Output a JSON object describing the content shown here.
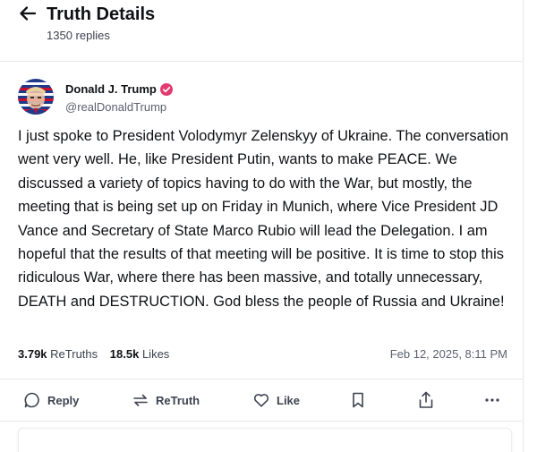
{
  "header": {
    "title": "Truth Details",
    "replies": "1350 replies"
  },
  "post": {
    "author": {
      "name": "Donald J. Trump",
      "handle": "@realDonaldTrump",
      "verified": true
    },
    "text": "I just spoke to President Volodymyr Zelenskyy of Ukraine. The conversation went very well. He, like President Putin, wants to make PEACE. We discussed a variety of topics having to do with the War, but mostly, the meeting that is being set up on Friday in Munich, where Vice President JD Vance and Secretary of State Marco Rubio will lead the Delegation. I am hopeful that the results of that meeting will be positive. It is time to stop this ridiculous War, where there has been massive, and totally unnecessary, DEATH and DESTRUCTION. God bless the people of Russia and Ukraine!",
    "stats": {
      "retruths_count": "3.79k",
      "retruths_label": "ReTruths",
      "likes_count": "18.5k",
      "likes_label": "Likes"
    },
    "timestamp": "Feb 12, 2025, 8:11 PM"
  },
  "actions": {
    "reply": "Reply",
    "retruth": "ReTruth",
    "like": "Like"
  },
  "icons": {
    "back": "arrow-left-icon",
    "verified": "verified-badge-icon",
    "reply": "chat-bubble-icon",
    "retruth": "retruth-arrows-icon",
    "like": "heart-icon",
    "bookmark": "bookmark-icon",
    "share": "share-icon",
    "more": "more-dots-icon"
  },
  "colors": {
    "text": "#0f1115",
    "muted": "#5b6170",
    "divider": "#e6e7eb",
    "verified": "#e23b6f"
  }
}
